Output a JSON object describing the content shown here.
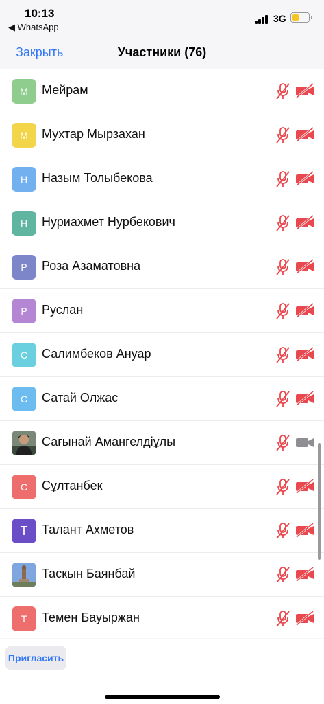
{
  "status_bar": {
    "time": "10:13",
    "back_app": "◀ WhatsApp",
    "network": "3G",
    "battery_level": 0.45,
    "battery_color": "#f3c623"
  },
  "nav": {
    "close_label": "Закрыть",
    "title": "Участники (76)"
  },
  "colors": {
    "accent": "#3478f6",
    "muted_icon": "#e8484e",
    "active_camera": "#8e8e93"
  },
  "participants": [
    {
      "name": "Мейрам",
      "initial": "М",
      "avatar_color": "#8fcd8f",
      "avatar_type": "letter",
      "mic": "muted",
      "camera": "off"
    },
    {
      "name": "Мухтар Мырзахан",
      "initial": "М",
      "avatar_color": "#f3d54a",
      "avatar_type": "letter",
      "mic": "muted",
      "camera": "off"
    },
    {
      "name": "Назым Толыбекова",
      "initial": "Н",
      "avatar_color": "#73b0ef",
      "avatar_type": "letter",
      "mic": "muted",
      "camera": "off"
    },
    {
      "name": "Нуриахмет Нурбекович",
      "initial": "Н",
      "avatar_color": "#5fb5a0",
      "avatar_type": "letter",
      "mic": "muted",
      "camera": "off"
    },
    {
      "name": "Роза Азаматовна",
      "initial": "Р",
      "avatar_color": "#7d86c9",
      "avatar_type": "letter",
      "mic": "muted",
      "camera": "off"
    },
    {
      "name": "Руслан",
      "initial": "Р",
      "avatar_color": "#b486d4",
      "avatar_type": "letter",
      "mic": "muted",
      "camera": "off"
    },
    {
      "name": "Салимбеков Ануар",
      "initial": "С",
      "avatar_color": "#6ad0e0",
      "avatar_type": "letter",
      "mic": "muted",
      "camera": "off"
    },
    {
      "name": "Сатай Олжас",
      "initial": "С",
      "avatar_color": "#6cbcf0",
      "avatar_type": "letter",
      "mic": "muted",
      "camera": "off"
    },
    {
      "name": "Сағынай Амангелдіұлы",
      "initial": "",
      "avatar_color": "#4a5a4e",
      "avatar_type": "photo-person",
      "mic": "muted",
      "camera": "on"
    },
    {
      "name": "Сұлтанбек",
      "initial": "С",
      "avatar_color": "#ee6e6e",
      "avatar_type": "letter",
      "mic": "muted",
      "camera": "off"
    },
    {
      "name": "Талант Ахметов",
      "initial": "Т",
      "avatar_color": "#6b4ec7",
      "avatar_type": "letter-lg",
      "mic": "muted",
      "camera": "off"
    },
    {
      "name": "Таскын Баянбай",
      "initial": "",
      "avatar_color": "#6f9ad8",
      "avatar_type": "photo-monument",
      "mic": "muted",
      "camera": "off"
    },
    {
      "name": "Темен Бауыржан",
      "initial": "Т",
      "avatar_color": "#ee6e6e",
      "avatar_type": "letter",
      "mic": "muted",
      "camera": "off"
    },
    {
      "name": "",
      "initial": "",
      "avatar_color": "#ffffff",
      "avatar_type": "letter",
      "mic": "muted",
      "camera": "off"
    }
  ],
  "footer": {
    "invite_label": "Пригласить"
  }
}
